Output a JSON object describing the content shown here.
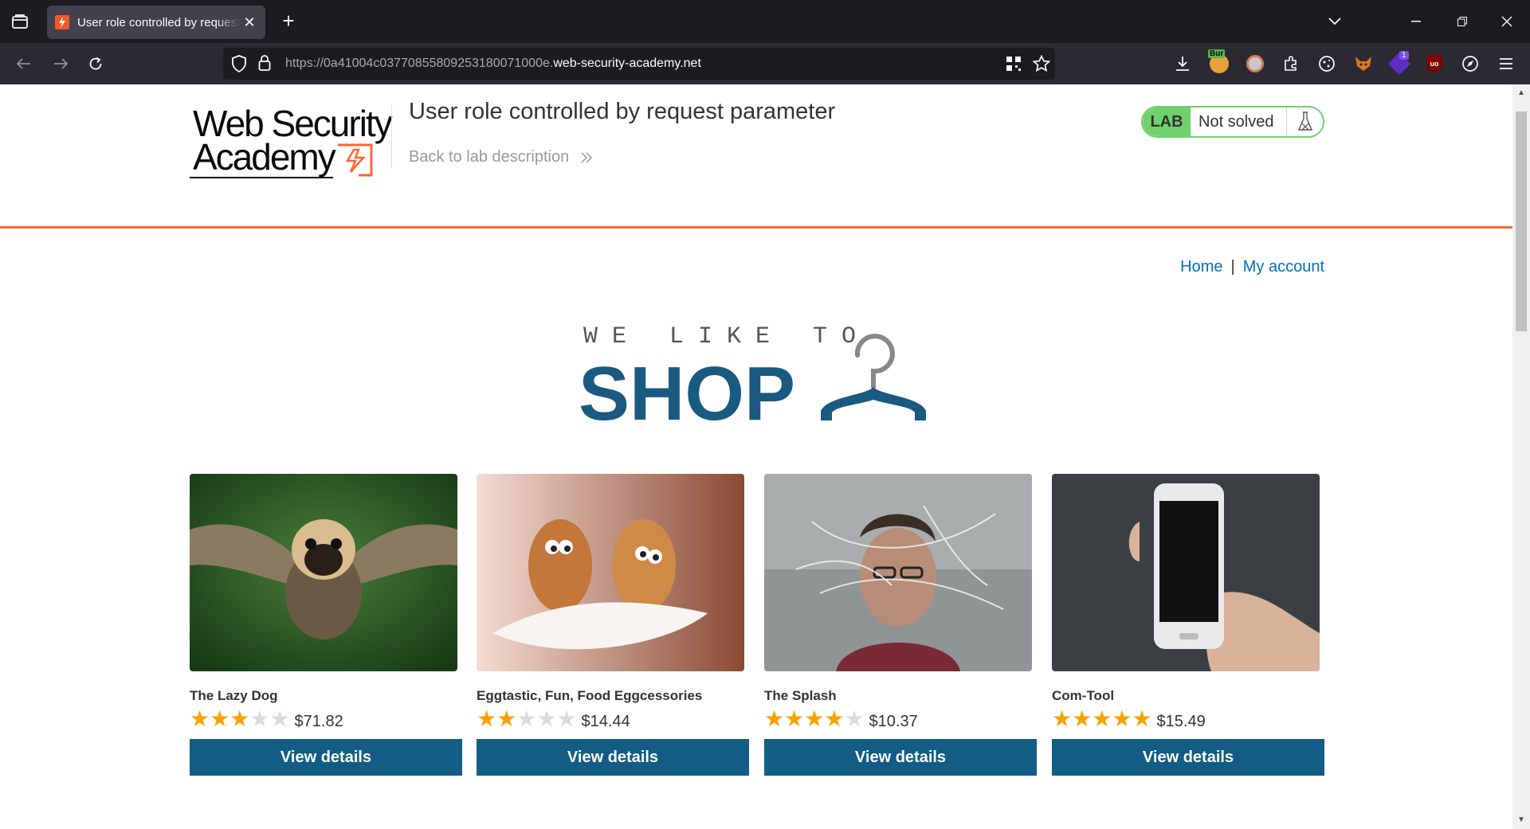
{
  "browser": {
    "tab_title": "User role controlled by request",
    "url_prefix": "https://0a41004c0377085580925318007100​0e.",
    "url_domain": "web-security-academy.net",
    "extensions": [
      "download-icon",
      "burp-icon",
      "avatar-icon",
      "extensions-icon",
      "cookie-icon",
      "fox-icon",
      "notification-icon",
      "ublock-icon",
      "compass-icon",
      "menu-icon"
    ],
    "burp_label": "Bur",
    "notif_count": "1",
    "ublock_label": "uo"
  },
  "header": {
    "logo_line1": "Web Security",
    "logo_line2": "Academy",
    "lab_title": "User role controlled by request parameter",
    "back_link": "Back to lab description",
    "lab_badge": "LAB",
    "lab_state": "Not solved"
  },
  "nav": {
    "home": "Home",
    "separator": "|",
    "account": "My account"
  },
  "banner": {
    "small_text": "WE LIKE TO",
    "big_text": "SHOP"
  },
  "products": [
    {
      "name": "The Lazy Dog",
      "rating": 3,
      "price": "$71.82",
      "button": "View details"
    },
    {
      "name": "Eggtastic, Fun, Food Eggcessories",
      "rating": 2,
      "price": "$14.44",
      "button": "View details"
    },
    {
      "name": "The Splash",
      "rating": 4,
      "price": "$10.37",
      "button": "View details"
    },
    {
      "name": "Com-Tool",
      "rating": 5,
      "price": "$15.49",
      "button": "View details"
    }
  ],
  "colors": {
    "accent_orange": "#ff6633",
    "lab_green": "#70d16d",
    "button_blue": "#135c85",
    "link_blue": "#0071bc",
    "star_gold": "#f9a200"
  }
}
